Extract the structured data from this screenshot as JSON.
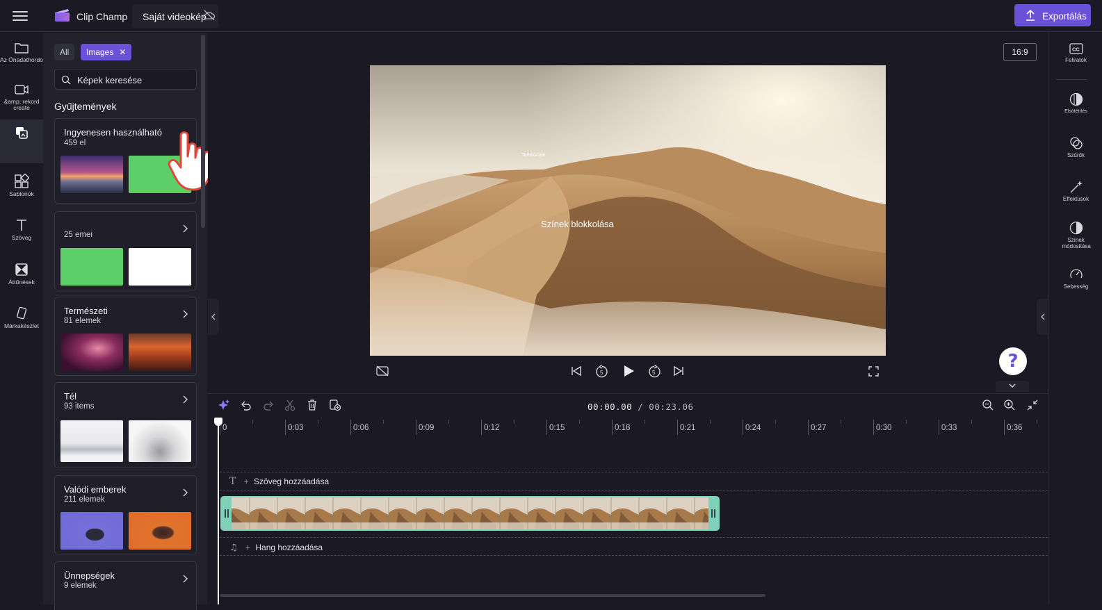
{
  "app": {
    "name": "Clip Champ",
    "project_name": "Saját videokép",
    "export_label": "Exportálás",
    "accent": "#6a52d8"
  },
  "left_rail": {
    "items": [
      {
        "label": "Az Önadathordozója",
        "icon": "folder-icon"
      },
      {
        "label": "&amp; rekord create",
        "icon": "camera-icon"
      },
      {
        "label": "",
        "icon": "content-library-icon"
      },
      {
        "label": "Sablonok",
        "icon": "templates-icon"
      },
      {
        "label": "Szöveg",
        "icon": "text-icon"
      },
      {
        "label": "Áttűnések",
        "icon": "transitions-icon"
      },
      {
        "label": "Márkakészlet",
        "icon": "brand-kit-icon"
      }
    ]
  },
  "panel": {
    "filters": {
      "all": "All",
      "images": "Images",
      "images_close": "✕"
    },
    "search": {
      "placeholder": "Képek keresése",
      "value": ""
    },
    "section_title": "Gyűjtemények",
    "collections": [
      {
        "title": "Ingyenesen használható",
        "count": "459",
        "unit": "el"
      },
      {
        "title": "",
        "count": "25",
        "unit": "emei"
      },
      {
        "title": "Természeti",
        "count": "81",
        "unit": "elemek"
      },
      {
        "title": "Tél",
        "count": "93",
        "unit": "items"
      },
      {
        "title": "Valódi emberek",
        "count": "211",
        "unit": "elemek"
      },
      {
        "title": "Ünnepségek",
        "count": "9",
        "unit": "elemek"
      }
    ]
  },
  "preview": {
    "aspect_ratio": "16:9",
    "overlay_small": "Tartalomjár",
    "overlay_main": "Színek blokkolása",
    "help": "?"
  },
  "right_rail": {
    "items": [
      {
        "label": "Feliratok",
        "icon": "captions-icon"
      },
      {
        "label": "Elsötétítés",
        "icon": "fade-icon"
      },
      {
        "label": "Szűrők",
        "icon": "filters-icon"
      },
      {
        "label": "Effektusok",
        "icon": "effects-icon"
      },
      {
        "label": "Színek módosítása",
        "icon": "adjust-colors-icon"
      },
      {
        "label": "Sebesség",
        "icon": "speed-icon"
      }
    ]
  },
  "timeline": {
    "current_time": "00:00.00",
    "separator": " / ",
    "total_time": "00:23.06",
    "ticks": [
      "0",
      "0:03",
      "0:06",
      "0:09",
      "0:12",
      "0:15",
      "0:18",
      "0:21",
      "0:24",
      "0:27",
      "0:30",
      "0:33",
      "0:36"
    ],
    "add_text": "Szöveg hozzáadása",
    "add_audio": "Hang hozzáadása",
    "clip_color": "#7fd1b9"
  }
}
